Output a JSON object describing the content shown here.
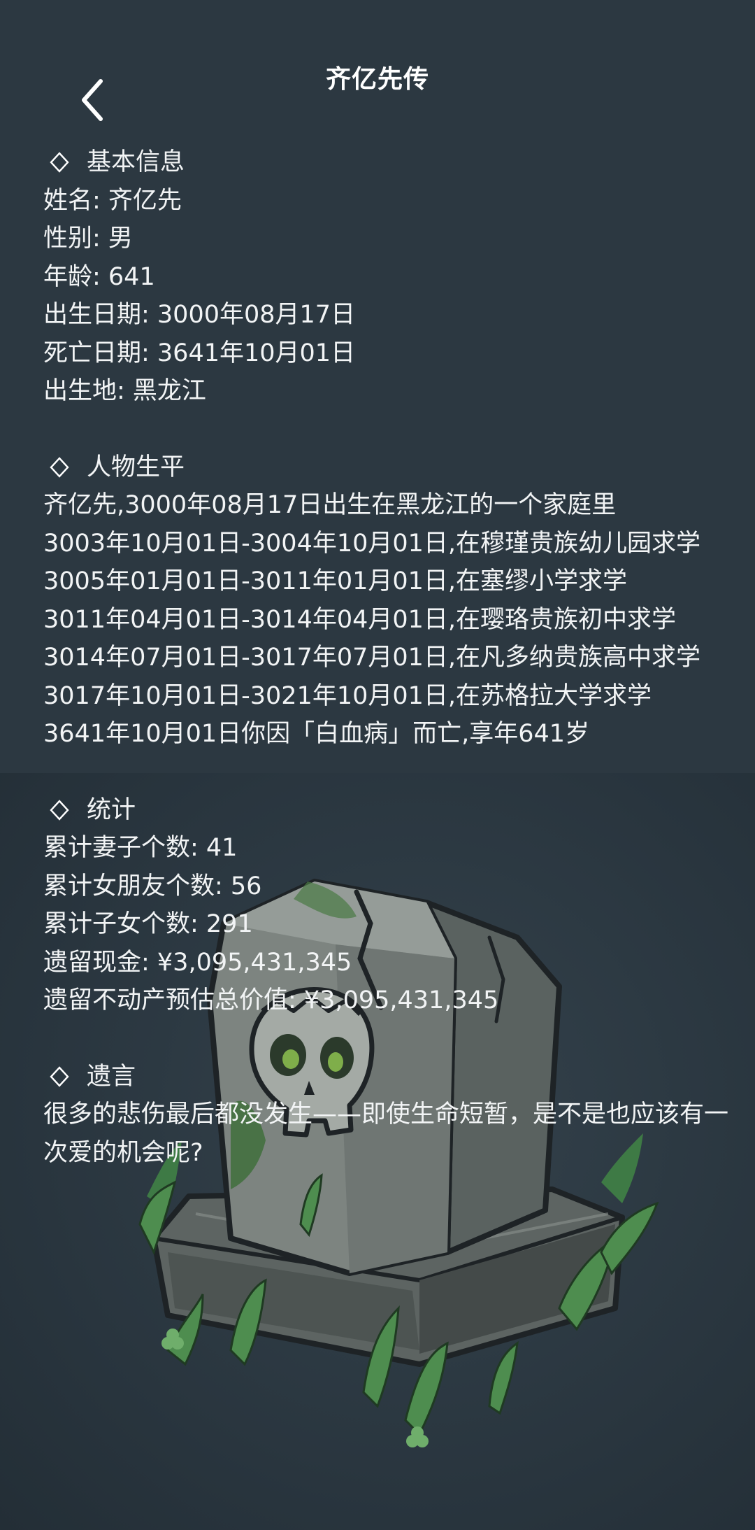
{
  "header": {
    "title": "齐亿先传",
    "back_icon": "chevron-left-icon"
  },
  "basic_info": {
    "heading": "基本信息",
    "lines": [
      "姓名: 齐亿先",
      "性别: 男",
      "年龄: 641",
      "出生日期: 3000年08月17日",
      "死亡日期: 3641年10月01日",
      "出生地: 黑龙江"
    ]
  },
  "life": {
    "heading": "人物生平",
    "lines": [
      "齐亿先,3000年08月17日出生在黑龙江的一个家庭里",
      "3003年10月01日-3004年10月01日,在穆瑾贵族幼儿园求学",
      "3005年01月01日-3011年01月01日,在塞缪小学求学",
      "3011年04月01日-3014年04月01日,在璎珞贵族初中求学",
      "3014年07月01日-3017年07月01日,在凡多纳贵族高中求学",
      "3017年10月01日-3021年10月01日,在苏格拉大学求学",
      "3641年10月01日你因「白血病」而亡,享年641岁"
    ]
  },
  "stats": {
    "heading": "统计",
    "lines": [
      "累计妻子个数: 41",
      "累计女朋友个数: 56",
      "累计子女个数: 291",
      "遗留现金: ¥3,095,431,345",
      "遗留不动产预估总价值: ¥3,095,431,345"
    ]
  },
  "will": {
    "heading": "遗言",
    "text": "很多的悲伤最后都没发生——即使生命短暂，是不是也应该有一次爱的机会呢?"
  },
  "colors": {
    "background": "#2c3942",
    "text": "#ffffff",
    "stone": "#7d8480",
    "moss": "#3f6e3c",
    "grass": "#4e8d4f"
  },
  "icons": {
    "section": "diamond-outline-icon",
    "illustration": "tombstone-skull-illustration"
  }
}
